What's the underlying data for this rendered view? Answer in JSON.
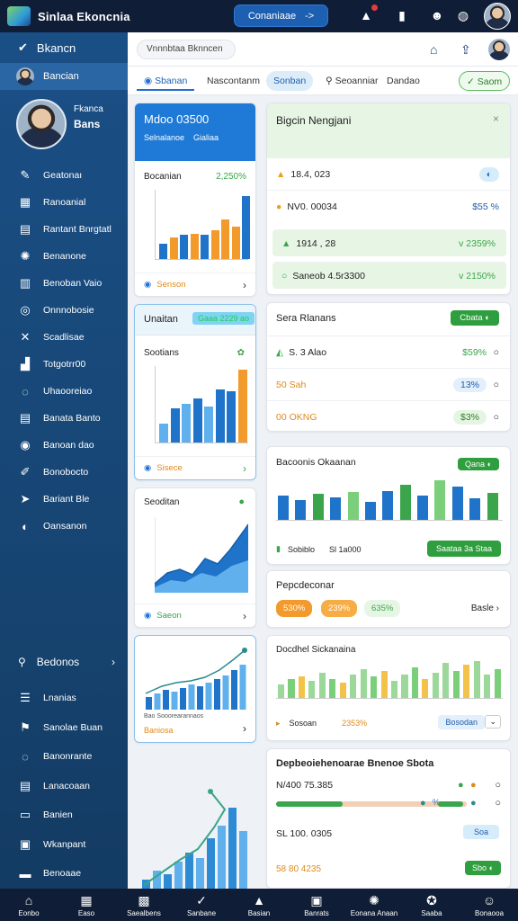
{
  "topbar": {
    "app_title": "Sinlaa Ekoncnia",
    "action_label": "Conaniaae",
    "action_arrow": "->"
  },
  "sidebar": {
    "brand": "Bkancn",
    "user_label": "Bancian",
    "profile_line1": "Fkanca",
    "profile_line2": "Bans",
    "items": [
      {
        "label": "Geatonaı",
        "icon": "chart-icon"
      },
      {
        "label": "Ranoanial",
        "icon": "grid-icon"
      },
      {
        "label": "Rantant Bnrgtatl",
        "icon": "document-icon"
      },
      {
        "label": "Benanone",
        "icon": "gear-icon"
      },
      {
        "label": "Benoban Vaio",
        "icon": "calendar-icon"
      },
      {
        "label": "Onnnobosie",
        "icon": "refresh-icon"
      },
      {
        "label": "Scadlisae",
        "icon": "tools-icon"
      },
      {
        "label": "Totgotrr00",
        "icon": "bar-chart-icon"
      },
      {
        "label": "Uhaooreiao",
        "icon": "compass-icon"
      },
      {
        "label": "Banata Banto",
        "icon": "table-icon"
      },
      {
        "label": "Banoan dao",
        "icon": "circle-icon"
      },
      {
        "label": "Bonobocto",
        "icon": "edit-icon"
      },
      {
        "label": "Bariant Ble",
        "icon": "send-icon"
      },
      {
        "label": "Oansanon",
        "icon": "user-circle-icon"
      }
    ],
    "section_label": "Bedonos",
    "lower_items": [
      {
        "label": "Lnanias",
        "icon": "list-icon"
      },
      {
        "label": "Sanolae Buan",
        "icon": "flag-icon"
      },
      {
        "label": "Banonrante",
        "icon": "compass-icon"
      },
      {
        "label": "Lanacoaan",
        "icon": "table-icon"
      },
      {
        "label": "Banien",
        "icon": "panel-icon"
      },
      {
        "label": "Wkanpant",
        "icon": "image-icon"
      },
      {
        "label": "Benoaae",
        "icon": "car-icon"
      }
    ]
  },
  "header": {
    "search_text": "Vnnnbtaa Bknncen"
  },
  "tabs": [
    {
      "label": "Sbanan",
      "icon": "circle-icon"
    },
    {
      "label": "Nascontanm",
      "icon": ""
    },
    {
      "label": "Sonban",
      "icon": ""
    },
    {
      "label": "Seoanniar",
      "icon": "search-icon"
    },
    {
      "label": "Dandao",
      "icon": ""
    },
    {
      "label": "Saom",
      "icon": "check-icon"
    }
  ],
  "card1": {
    "title": "Mdoo 03500",
    "sub1": "Selnalanoe",
    "sub2": "Gialiaa",
    "chart_title": "Bocanian",
    "chart_value": "2,250%",
    "footer": "Senson",
    "colors": {
      "header": "#1e7ad6",
      "blue": "#1f74c9",
      "orange": "#f39a2c"
    }
  },
  "card2": {
    "tag": "Unaitan",
    "tag_value": "Gaaa 2229 ao",
    "chart_title": "Sootians",
    "footer": "Sisece"
  },
  "card3": {
    "chart_title": "Seoditan",
    "footer": "Saeon"
  },
  "card4": {
    "footer_line1": "Bao Sooorearannaos",
    "footer_line2": "Baniosa"
  },
  "panel1": {
    "title": "Bigcin Nengjani",
    "rows": [
      {
        "label": "18.4, 023",
        "value": ""
      },
      {
        "label": "NV0. 00034",
        "value": "$55 %"
      },
      {
        "label": "1914 , 28",
        "value": "v 2359%"
      },
      {
        "label": "Saneob 4.5r3300",
        "value": "v 2150%"
      }
    ]
  },
  "panel2": {
    "title": "Sera Rlanans",
    "button": "Cbata",
    "rows": [
      {
        "label": "S. 3 Alao",
        "value": "$59%"
      },
      {
        "label": "50 Sah",
        "value": "13%"
      },
      {
        "label": "00 OKNG",
        "value": "$3%"
      }
    ]
  },
  "panel3": {
    "title": "Bacoonis Okaanan",
    "badge": "Qana",
    "legend": "Sobiblo",
    "legend_value": "Sl 1a000",
    "button": "Saataa 3a Staa"
  },
  "panel4": {
    "title": "Pepcdeconar",
    "pill1": "530%",
    "pill2": "239%",
    "pill3": "635%",
    "link": "Basle"
  },
  "panel5": {
    "title": "Docdhel Sickanaina",
    "footer1": "Sosoan",
    "footer2": "2353%",
    "button": "Bosodan"
  },
  "panel6": {
    "title": "Depbeoiehenoarae Bnenoe Sbota",
    "row1": "N/400 75.385",
    "row2": "SL 100. 0305",
    "row2_btn": "Soa",
    "row3": "58 80 4235",
    "row3_btn": "Sbo"
  },
  "bottombar": [
    {
      "label": "Eonbo",
      "icon": "home-icon"
    },
    {
      "label": "Easo",
      "icon": "grid-icon"
    },
    {
      "label": "Saealbens",
      "icon": "film-icon"
    },
    {
      "label": "Sanbane",
      "icon": "check-circle-icon"
    },
    {
      "label": "Basian",
      "icon": "lock-icon"
    },
    {
      "label": "Banrats",
      "icon": "image-icon"
    },
    {
      "label": "Eonana Anaan",
      "icon": "gear-icon"
    },
    {
      "label": "Saaba",
      "icon": "soccer-icon"
    },
    {
      "label": "Bonaooa",
      "icon": "avatar-icon"
    }
  ],
  "charts": {
    "card1_bars": [
      {
        "v": 2,
        "c": "blue"
      },
      {
        "v": 2.8,
        "c": "orange"
      },
      {
        "v": 3.2,
        "c": "blue"
      },
      {
        "v": 3.3,
        "c": "orange"
      },
      {
        "v": 3.1,
        "c": "blue"
      },
      {
        "v": 3.8,
        "c": "orange"
      },
      {
        "v": 5.2,
        "c": "orange"
      },
      {
        "v": 4.2,
        "c": "orange"
      },
      {
        "v": 8.2,
        "c": "blue"
      }
    ],
    "card2_bars": [
      {
        "v": 2.2,
        "c": "lblue"
      },
      {
        "v": 4,
        "c": "blue"
      },
      {
        "v": 4.6,
        "c": "lblue"
      },
      {
        "v": 5.2,
        "c": "blue"
      },
      {
        "v": 4.2,
        "c": "lblue"
      },
      {
        "v": 6.2,
        "c": "blue"
      },
      {
        "v": 6,
        "c": "blue"
      },
      {
        "v": 8.6,
        "c": "orange"
      }
    ],
    "panel3_bars": [
      3.2,
      2.6,
      3.4,
      3,
      3.6,
      2.4,
      3.8,
      4.6,
      3.2,
      5.2,
      4.4,
      2.8,
      3.5
    ],
    "panel5_bars": [
      1.4,
      2.0,
      2.2,
      1.8,
      2.6,
      2.0,
      1.6,
      2.4,
      3.0,
      2.2,
      2.8,
      1.8,
      2.4,
      3.2,
      2.0,
      2.6,
      3.6,
      2.8,
      3.4,
      3.8,
      2.4,
      3.0
    ]
  }
}
